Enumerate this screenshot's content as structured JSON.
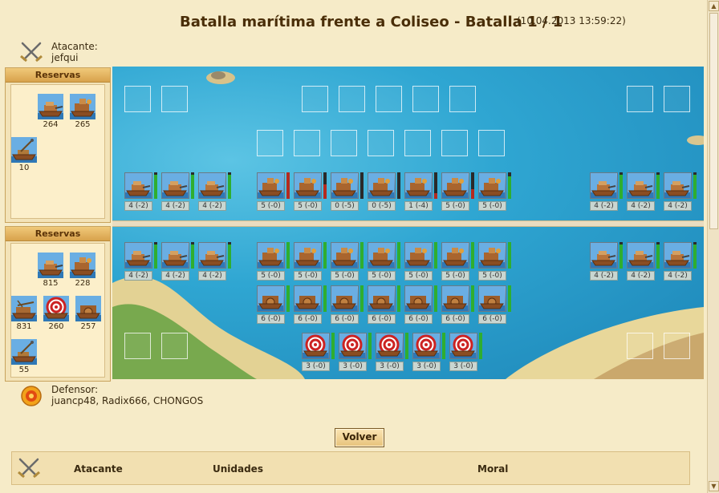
{
  "header": {
    "title": "Batalla marítima frente a Coliseo - Batalla 1 / 1",
    "date": "(10.04.2013 13:59:22)"
  },
  "attacker": {
    "role": "Atacante:",
    "name": "jefqui"
  },
  "defender": {
    "role": "Defensor:",
    "name": "juancp48, Radix666, CHONGOS"
  },
  "reserves_top": {
    "title": "Reservas",
    "units": [
      {
        "count": "264",
        "icon": "ram-ship-icon"
      },
      {
        "count": "265",
        "icon": "fire-ship-icon"
      },
      {
        "count": "10",
        "icon": "catapult-ship-icon"
      }
    ]
  },
  "reserves_bottom": {
    "title": "Reservas",
    "units": [
      {
        "count": "815",
        "icon": "ram-ship-icon"
      },
      {
        "count": "228",
        "icon": "fire-ship-icon"
      },
      {
        "count": "831",
        "icon": "ballista-ship-icon"
      },
      {
        "count": "260",
        "icon": "target-icon"
      },
      {
        "count": "257",
        "icon": "paddle-ship-icon"
      },
      {
        "count": "55",
        "icon": "catapult-ship-icon"
      }
    ]
  },
  "battle": {
    "attacker_front": [
      {
        "label": "4 (-2)",
        "hp": 0.9
      },
      {
        "label": "4 (-2)",
        "hp": 0.9
      },
      {
        "label": "4 (-2)",
        "hp": 0.9
      },
      {
        "label": "5 (-0)",
        "hp": 1
      },
      {
        "label": "5 (-0)",
        "hp": 0.55
      },
      {
        "label": "0 (-5)",
        "hp": 0.0
      },
      {
        "label": "0 (-5)",
        "hp": 0.0
      },
      {
        "label": "1 (-4)",
        "hp": 0.2
      },
      {
        "label": "5 (-0)",
        "hp": 0.35
      },
      {
        "label": "5 (-0)",
        "hp": 0.85
      },
      {
        "label": "4 (-2)",
        "hp": 0.9
      },
      {
        "label": "4 (-2)",
        "hp": 0.9
      },
      {
        "label": "4 (-2)",
        "hp": 0.9
      }
    ],
    "defender_front": [
      {
        "label": "4 (-2)",
        "hp": 0.9
      },
      {
        "label": "4 (-2)",
        "hp": 0.9
      },
      {
        "label": "4 (-2)",
        "hp": 0.9
      },
      {
        "label": "5 (-0)",
        "hp": 1
      },
      {
        "label": "5 (-0)",
        "hp": 1
      },
      {
        "label": "5 (-0)",
        "hp": 1
      },
      {
        "label": "5 (-0)",
        "hp": 1
      },
      {
        "label": "5 (-0)",
        "hp": 1
      },
      {
        "label": "5 (-0)",
        "hp": 1
      },
      {
        "label": "5 (-0)",
        "hp": 1
      },
      {
        "label": "4 (-2)",
        "hp": 0.9
      },
      {
        "label": "4 (-2)",
        "hp": 0.9
      },
      {
        "label": "4 (-2)",
        "hp": 0.9
      }
    ],
    "defender_mid": [
      {
        "label": "6 (-0)",
        "hp": 1
      },
      {
        "label": "6 (-0)",
        "hp": 1
      },
      {
        "label": "6 (-0)",
        "hp": 1
      },
      {
        "label": "6 (-0)",
        "hp": 1
      },
      {
        "label": "6 (-0)",
        "hp": 1
      },
      {
        "label": "6 (-0)",
        "hp": 1
      },
      {
        "label": "6 (-0)",
        "hp": 1
      }
    ],
    "defender_back": [
      {
        "label": "3 (-0)",
        "hp": 1
      },
      {
        "label": "3 (-0)",
        "hp": 1
      },
      {
        "label": "3 (-0)",
        "hp": 1
      },
      {
        "label": "3 (-0)",
        "hp": 1
      },
      {
        "label": "3 (-0)",
        "hp": 1
      }
    ]
  },
  "buttons": {
    "volver": "Volver"
  },
  "report": {
    "col_attacker": "Atacante",
    "col_units": "Unidades",
    "col_morale": "Moral"
  },
  "colors": {
    "hp_full": "#2fae2f",
    "hp_damaged": "#b52a1f",
    "sea": "#2c9fc9",
    "sand": "#e8d79a"
  }
}
